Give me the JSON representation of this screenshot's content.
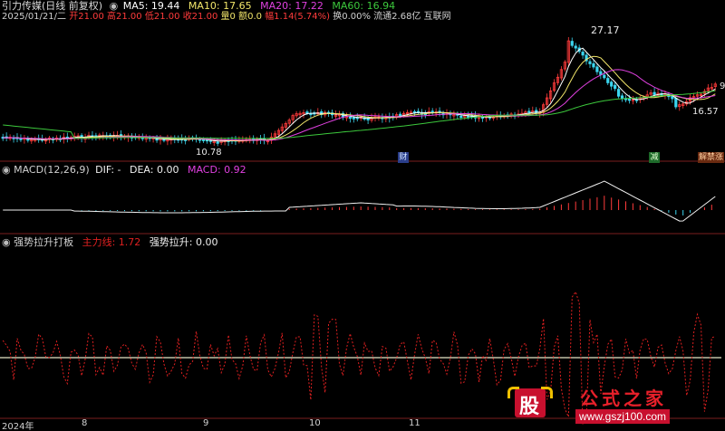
{
  "colors": {
    "background": "#000000",
    "separator": "#7a1e1e",
    "up": "#ff3b3b",
    "down": "#3bd6f0",
    "ma5": "#ffffff",
    "ma10": "#f1e56a",
    "ma20": "#e040e0",
    "ma60": "#3cc83c",
    "macd_dif": "#f0f0f0",
    "macd_label": "#e040e0",
    "main_force_line": "#e02020",
    "strong_line": "#ffffff"
  },
  "header": {
    "title": "引力传媒(日线 前复权)",
    "ma5": "MA5: 19.44",
    "ma10": "MA10: 17.65",
    "ma20": "MA20: 17.22",
    "ma60": "MA60: 16.94"
  },
  "quote": {
    "date": "2025/01/21/二",
    "open": "开21.00",
    "high": "高21.00",
    "low": "低21.00",
    "close": "收21.00",
    "volume": "量0",
    "amount": "额0.0",
    "change": "幅1.14(5.74%)",
    "turnover": "换0.00%",
    "float": "流通2.68亿",
    "sector": "互联网"
  },
  "price_panel": {
    "high_mark": "27.17",
    "low_mark": "10.78",
    "right_mark": "16.57",
    "right_top_mark": "9",
    "badge_cai": "财",
    "badge_jian": "减",
    "badge_zt": "解禁涨"
  },
  "macd_panel": {
    "title": "MACD(12,26,9)",
    "dif": "DIF: -",
    "dea": "DEA: 0.00",
    "macd": "MACD: 0.92"
  },
  "indicator_panel": {
    "title": "强势拉升打板",
    "main_force": "主力线: 1.72",
    "strong_rise": "强势拉升: 0.00"
  },
  "time_axis": {
    "labels": [
      "2024年",
      "8",
      "9",
      "10",
      "11"
    ]
  },
  "watermark": {
    "logo_char": "股",
    "site_name": "公式之家",
    "url": "www.gszj100.com"
  }
}
